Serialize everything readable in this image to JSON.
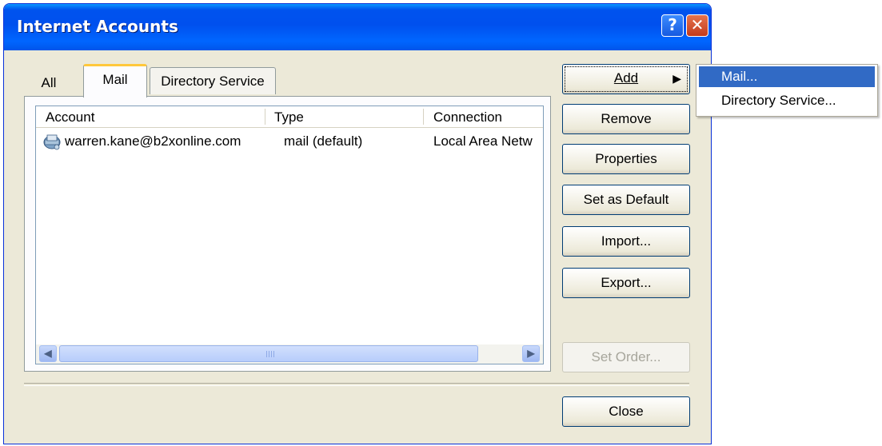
{
  "window": {
    "title": "Internet Accounts",
    "help_glyph": "?",
    "close_glyph": "✕"
  },
  "tabs": [
    {
      "label": "All",
      "selected": false
    },
    {
      "label": "Mail",
      "selected": true
    },
    {
      "label": "Directory Service",
      "selected": false
    }
  ],
  "list": {
    "columns": [
      "Account",
      "Type",
      "Connection"
    ],
    "rows": [
      {
        "account": "warren.kane@b2xonline.com",
        "type": "mail (default)",
        "connection": "Local Area Netw",
        "icon": "mail-account-icon"
      }
    ]
  },
  "scrollbar": {
    "left_arrow": "◀",
    "right_arrow": "▶"
  },
  "buttons": {
    "add": "Add",
    "add_arrow": "▶",
    "remove": "Remove",
    "properties": "Properties",
    "set_default": "Set as Default",
    "import": "Import...",
    "export": "Export...",
    "set_order": "Set Order...",
    "close": "Close"
  },
  "add_menu": {
    "items": [
      "Mail...",
      "Directory Service..."
    ],
    "highlighted": "Mail..."
  },
  "colors": {
    "titlebar": "#0055ea",
    "menu_highlight": "#316ac5",
    "dialog_bg": "#ece9d8"
  }
}
